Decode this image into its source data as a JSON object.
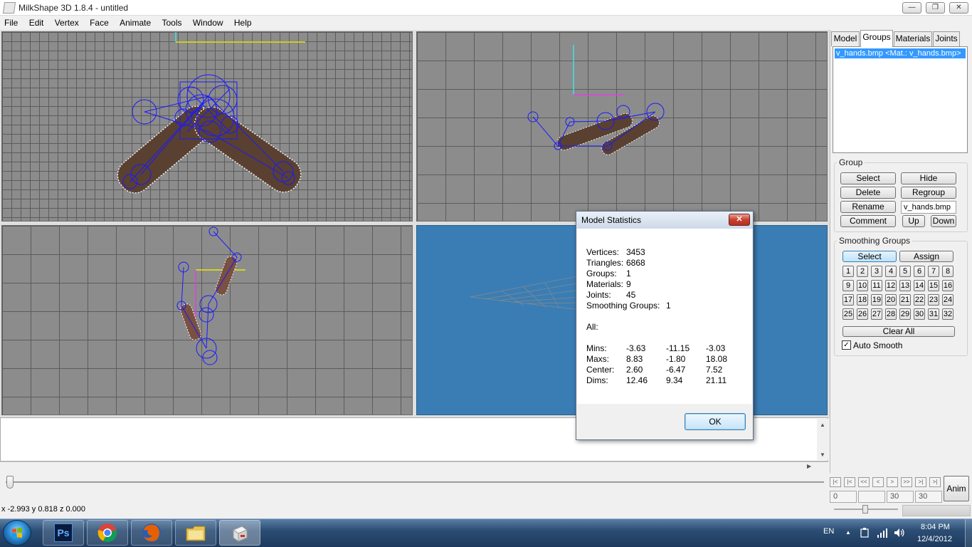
{
  "window": {
    "title": "MilkShape 3D 1.8.4 - untitled",
    "minimize_glyph": "—",
    "maximize_glyph": "❐",
    "close_glyph": "✕"
  },
  "menu": [
    "File",
    "Edit",
    "Vertex",
    "Face",
    "Animate",
    "Tools",
    "Window",
    "Help"
  ],
  "tabs": [
    "Model",
    "Groups",
    "Materials",
    "Joints"
  ],
  "active_tab": "Groups",
  "groups_panel": {
    "list_items": [
      "v_hands.bmp <Mat.: v_hands.bmp>"
    ],
    "group_box_title": "Group",
    "buttons": {
      "select": "Select",
      "hide": "Hide",
      "delete": "Delete",
      "regroup": "Regroup",
      "rename": "Rename",
      "comment": "Comment",
      "up": "Up",
      "down": "Down"
    },
    "rename_value": "v_hands.bmp",
    "smoothing_title": "Smoothing Groups",
    "smoothing_select": "Select",
    "smoothing_assign": "Assign",
    "smoothing_numbers": [
      "1",
      "2",
      "3",
      "4",
      "5",
      "6",
      "7",
      "8",
      "9",
      "10",
      "11",
      "12",
      "13",
      "14",
      "15",
      "16",
      "17",
      "18",
      "19",
      "20",
      "21",
      "22",
      "23",
      "24",
      "25",
      "26",
      "27",
      "28",
      "29",
      "30",
      "31",
      "32"
    ],
    "clear_all": "Clear All",
    "auto_smooth_label": "Auto Smooth",
    "auto_smooth_checked": true,
    "check_glyph": "✓"
  },
  "timeline": {
    "nav_glyphs": [
      "|<",
      "|<",
      "<<",
      "<",
      ">",
      ">>",
      ">|",
      ">|"
    ],
    "frame_start": "0",
    "frame_current": "",
    "frame_end": "30",
    "frame_total": "30",
    "anim_label": "Anim"
  },
  "status": {
    "coords": "x -2.993 y 0.818 z 0.000"
  },
  "dialog": {
    "title": "Model Statistics",
    "close_glyph": "✕",
    "counts": [
      {
        "label": "Vertices:",
        "value": "3453"
      },
      {
        "label": "Triangles:",
        "value": "6868"
      },
      {
        "label": "Groups:",
        "value": "1"
      },
      {
        "label": "Materials:",
        "value": "9"
      },
      {
        "label": "Joints:",
        "value": "45"
      },
      {
        "label": "Smoothing Groups:",
        "value": "1"
      }
    ],
    "all_label": "All:",
    "bounds": [
      {
        "label": "Mins:",
        "x": "-3.63",
        "y": "-11.15",
        "z": "-3.03"
      },
      {
        "label": "Maxs:",
        "x": "8.83",
        "y": "-1.80",
        "z": "18.08"
      },
      {
        "label": "Center:",
        "x": "2.60",
        "y": "-6.47",
        "z": "7.52"
      },
      {
        "label": "Dims:",
        "x": "12.46",
        "y": "9.34",
        "z": "21.11"
      }
    ],
    "ok_label": "OK"
  },
  "taskbar": {
    "ps_label": "Ps",
    "language": "EN",
    "tray_arrow": "▲",
    "time": "8:04 PM",
    "date": "12/4/2012"
  },
  "colors": {
    "selection_blue": "#3399ff",
    "viewport_gray": "#8c8c8c",
    "perspective_blue": "#3a7db4",
    "joint_blue": "#1a1aff",
    "bone_brown": "#5a4030",
    "close_red": "#c8412d"
  }
}
